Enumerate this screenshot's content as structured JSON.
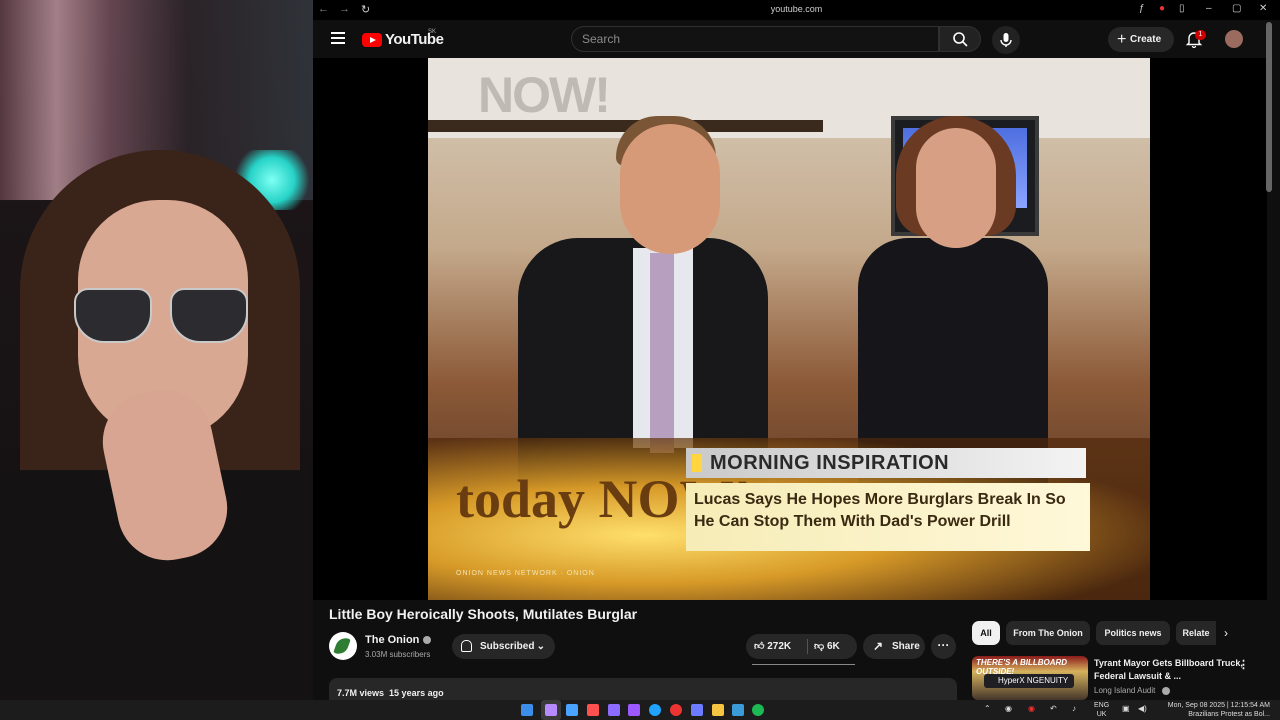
{
  "browser": {
    "url": "youtube.com"
  },
  "header": {
    "logo_text": "YouTube",
    "country_code": "SK",
    "search_placeholder": "Search",
    "create_label": "Create",
    "notification_count": "1"
  },
  "video": {
    "sign_text": "NOW!",
    "overlay_banner": "MORNING INSPIRATION",
    "overlay_headline": "Lucas Says He Hopes More Burglars Break In So He Can Stop Them With Dad's Power Drill",
    "show_logo": "today NOW!",
    "network_text": "ONION NEWS NETWORK · ONION",
    "title": "Little Boy Heroically Shoots, Mutilates Burglar",
    "channel_name": "The Onion",
    "subscribers": "3.03M subscribers",
    "subscribe_label": "Subscribed",
    "likes": "272K",
    "dislikes": "6K",
    "share_label": "Share",
    "more_label": "···",
    "views": "7.7M views",
    "age": "15 years ago"
  },
  "sidebar": {
    "chips": [
      {
        "label": "All"
      },
      {
        "label": "From The Onion"
      },
      {
        "label": "Politics news"
      },
      {
        "label": "Relate"
      }
    ],
    "recommendation": {
      "thumb_text": "THERE'S A BILLBOARD OUTSIDE!",
      "thumb_overlay": "HyperX NGENUITY",
      "title": "Tyrant Mayor Gets Billboard Truck, Federal Lawsuit & ...",
      "channel": "Long Island Audit"
    }
  },
  "taskbar": {
    "lang_top": "ENG",
    "lang_bottom": "UK",
    "clock": "Mon, Sep 08 2025 | 12:15:54 AM",
    "ticker": "Brazilians Protest as Bol..."
  },
  "colors": {
    "accent": "#ff0000",
    "background": "#0f0f0f",
    "chip_bg": "#272727"
  }
}
